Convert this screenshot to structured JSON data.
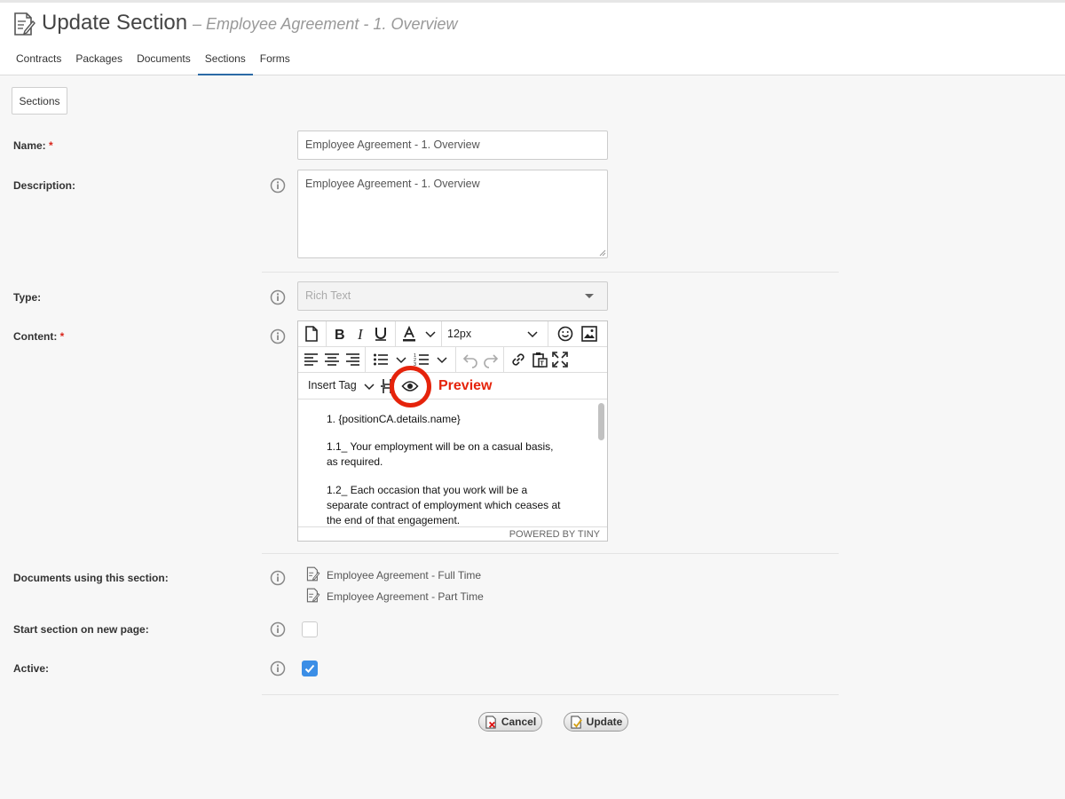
{
  "header": {
    "title": "Update Section",
    "subtitle": "– Employee Agreement - 1. Overview"
  },
  "nav": {
    "tabs": [
      {
        "label": "Contracts"
      },
      {
        "label": "Packages"
      },
      {
        "label": "Documents"
      },
      {
        "label": "Sections",
        "active": true
      },
      {
        "label": "Forms"
      }
    ]
  },
  "sections_button": "Sections",
  "form": {
    "name_label": "Name:",
    "required_mark": "*",
    "name_value": "Employee Agreement - 1. Overview",
    "description_label": "Description:",
    "description_value": "Employee Agreement - 1. Overview",
    "type_label": "Type:",
    "type_value": "Rich Text",
    "content_label": "Content:",
    "documents_label": "Documents using this section:",
    "documents": [
      "Employee Agreement - Full Time",
      "Employee Agreement - Part Time"
    ],
    "new_page_label": "Start section on new page:",
    "new_page_checked": false,
    "active_label": "Active:",
    "active_checked": true
  },
  "editor": {
    "font_size": "12px",
    "insert_tag": "Insert Tag",
    "preview_annotation": "Preview",
    "paragraphs": [
      "1. {positionCA.details.name}",
      "1.1_ Your employment will be on a casual basis, as required.",
      "1.2_ Each occasion that you work will be a separate contract of employment which ceases at the end of that engagement."
    ],
    "status_text": "POWERED BY TINY"
  },
  "actions": {
    "cancel": "Cancel",
    "update": "Update"
  },
  "colors": {
    "accent": "#2b6aa6",
    "highlight": "#e5230b",
    "checkbox_checked": "#3b8ee6",
    "required": "#d9261c"
  }
}
